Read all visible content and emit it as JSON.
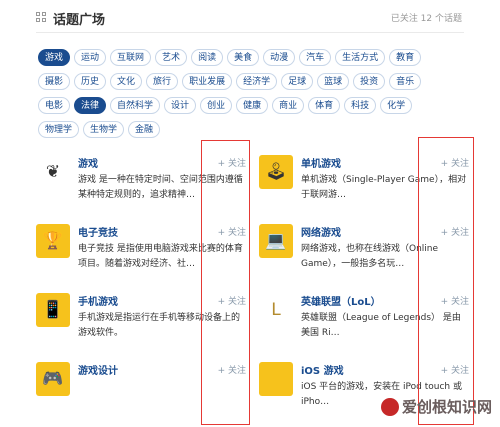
{
  "header": {
    "title": "话题广场",
    "count_text": "已关注 12 个话题"
  },
  "tag_rows": [
    [
      "游戏",
      "运动",
      "互联网",
      "艺术",
      "阅读",
      "美食",
      "动漫",
      "汽车",
      "生活方式",
      "教育"
    ],
    [
      "摄影",
      "历史",
      "文化",
      "旅行",
      "职业发展",
      "经济学",
      "足球",
      "篮球",
      "投资",
      "音乐"
    ],
    [
      "电影",
      "法律",
      "自然科学",
      "设计",
      "创业",
      "健康",
      "商业",
      "体育",
      "科技",
      "化学"
    ],
    [
      "物理学",
      "生物学",
      "金融"
    ]
  ],
  "active_tags": [
    "游戏",
    "法律"
  ],
  "follow_label": "+ 关注",
  "topics": [
    {
      "name": "游戏",
      "desc": "游戏 是一种在特定时间、空间范围内遵循某种特定规则的，追求精神…",
      "icon": "tree-icon",
      "color": "#ffffff"
    },
    {
      "name": "单机游戏",
      "desc": "单机游戏（Single-Player Game），相对于联网游…",
      "icon": "joystick-icon",
      "color": "#f6c21c"
    },
    {
      "name": "电子竞技",
      "desc": "电子竞技 是指使用电脑游戏来比赛的体育项目。随着游戏对经济、社…",
      "icon": "trophy-icon",
      "color": "#f6c21c"
    },
    {
      "name": "网络游戏",
      "desc": "网络游戏，也称在线游戏（Online Game），一般指多名玩…",
      "icon": "laptop-icon",
      "color": "#f6c21c"
    },
    {
      "name": "手机游戏",
      "desc": "手机游戏是指运行在手机等移动设备上的游戏软件。",
      "icon": "phone-icon",
      "color": "#f6c21c"
    },
    {
      "name": "英雄联盟（LoL）",
      "desc": "英雄联盟（League of Legends） 是由美国 Ri…",
      "icon": "lol-logo-icon",
      "color": "#ffffff"
    },
    {
      "name": "游戏设计",
      "desc": "",
      "icon": "gamepad-icon",
      "color": "#f6c21c"
    },
    {
      "name": "iOS 游戏",
      "desc": "iOS 平台的游戏，安装在 iPod touch 或 iPho…",
      "icon": "apple-icon",
      "color": "#f6c21c"
    }
  ],
  "watermark": "爱创根知识网"
}
